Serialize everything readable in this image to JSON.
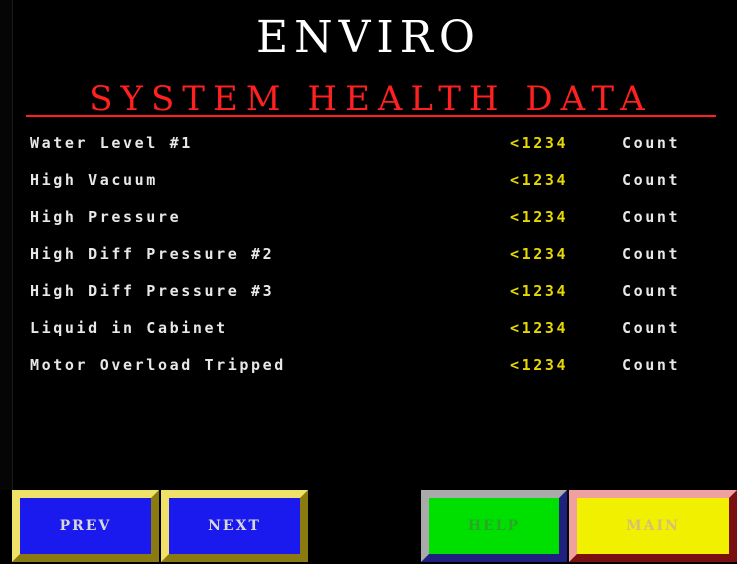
{
  "header": {
    "title": "ENVIRO",
    "section_title": "SYSTEM HEALTH DATA"
  },
  "rows": [
    {
      "label": "Water Level #1",
      "value": "<1234",
      "unit": "Count"
    },
    {
      "label": "High Vacuum",
      "value": "<1234",
      "unit": "Count"
    },
    {
      "label": "High Pressure",
      "value": "<1234",
      "unit": "Count"
    },
    {
      "label": "High Diff Pressure #2",
      "value": "<1234",
      "unit": "Count"
    },
    {
      "label": "High Diff Pressure #3",
      "value": "<1234",
      "unit": "Count"
    },
    {
      "label": "Liquid in Cabinet",
      "value": "<1234",
      "unit": "Count"
    },
    {
      "label": "Motor Overload Tripped",
      "value": "<1234",
      "unit": "Count"
    }
  ],
  "footer": {
    "prev_label": "PREV",
    "next_label": "NEXT",
    "help_label": "HELP",
    "main_label": "MAIN"
  },
  "colors": {
    "background": "#000000",
    "title": "#ffffff",
    "section_title": "#ff2020",
    "value": "#e6d800",
    "label": "#e8e8e8",
    "nav_button": "#1a1aee",
    "help_button": "#00e000",
    "main_button": "#f0f000"
  }
}
